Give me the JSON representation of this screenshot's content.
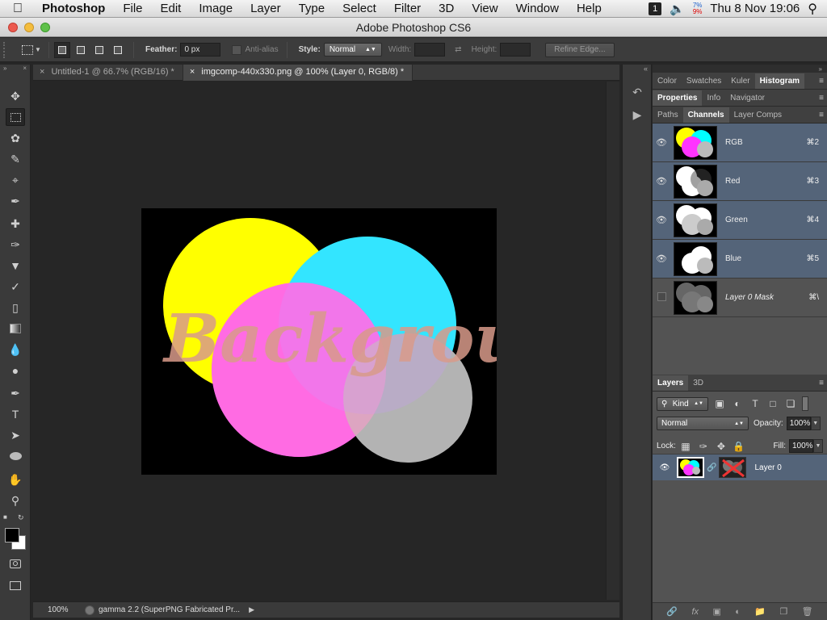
{
  "menubar": {
    "app": "Photoshop",
    "items": [
      "File",
      "Edit",
      "Image",
      "Layer",
      "Type",
      "Select",
      "Filter",
      "3D",
      "View",
      "Window",
      "Help"
    ],
    "badge": "1",
    "battery_top": "7%",
    "battery_bottom": "9%",
    "clock": "Thu 8 Nov  19:06"
  },
  "window": {
    "title": "Adobe Photoshop CS6"
  },
  "options": {
    "feather_label": "Feather:",
    "feather_value": "0 px",
    "antialias_label": "Anti-alias",
    "style_label": "Style:",
    "style_value": "Normal",
    "width_label": "Width:",
    "height_label": "Height:",
    "refine_edge": "Refine Edge..."
  },
  "doc_tabs": [
    {
      "label": "Untitled-1 @ 66.7% (RGB/16) *",
      "active": false
    },
    {
      "label": "imgcomp-440x330.png @ 100% (Layer 0, RGB/8) *",
      "active": true
    }
  ],
  "canvas": {
    "overlay_text": "Background"
  },
  "status": {
    "zoom": "100%",
    "info": "gamma 2.2 (SuperPNG Fabricated Pr..."
  },
  "panel_groups": {
    "group1_tabs": [
      "Color",
      "Swatches",
      "Kuler",
      "Histogram"
    ],
    "group2_tabs": [
      "Properties",
      "Info",
      "Navigator"
    ],
    "group3_tabs": [
      "Paths",
      "Channels",
      "Layer Comps"
    ]
  },
  "channels": [
    {
      "name": "RGB",
      "shortcut": "⌘2",
      "visible": true,
      "selected": true,
      "italic": false
    },
    {
      "name": "Red",
      "shortcut": "⌘3",
      "visible": true,
      "selected": true,
      "italic": false
    },
    {
      "name": "Green",
      "shortcut": "⌘4",
      "visible": true,
      "selected": true,
      "italic": false
    },
    {
      "name": "Blue",
      "shortcut": "⌘5",
      "visible": true,
      "selected": true,
      "italic": false
    },
    {
      "name": "Layer 0 Mask",
      "shortcut": "⌘\\",
      "visible": false,
      "selected": false,
      "italic": true
    }
  ],
  "layers_panel": {
    "tabs": [
      "Layers",
      "3D"
    ],
    "kind_label": "Kind",
    "blend_mode": "Normal",
    "opacity_label": "Opacity:",
    "opacity_value": "100%",
    "lock_label": "Lock:",
    "fill_label": "Fill:",
    "fill_value": "100%",
    "layer_name": "Layer 0"
  },
  "colors": {
    "yellow": "#ffff00",
    "cyan": "#00ffff",
    "magenta": "#ff33ff",
    "gray": "#b3b3b3",
    "selection": "#546479"
  }
}
